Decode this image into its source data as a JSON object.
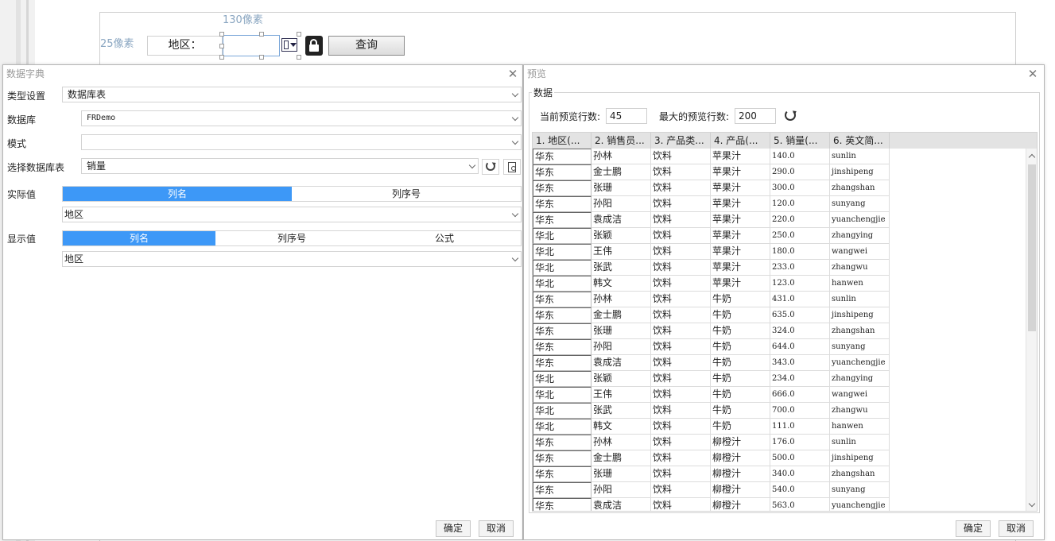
{
  "designer": {
    "dim_top": "130像素",
    "dim_left": "25像素",
    "region_label": "地区：",
    "query_button": "查询"
  },
  "dict_dialog": {
    "title": "数据字典",
    "type_label": "类型设置",
    "type_value": "数据库表",
    "db_label": "数据库",
    "db_value": "FRDemo",
    "mode_label": "模式",
    "mode_value": "",
    "table_label": "选择数据库表",
    "table_value": "销量",
    "actual_label": "实际值",
    "actual_tabs": [
      "列名",
      "列序号"
    ],
    "actual_value": "地区",
    "display_label": "显示值",
    "display_tabs": [
      "列名",
      "列序号",
      "公式"
    ],
    "display_value": "地区",
    "ok": "确定",
    "cancel": "取消"
  },
  "preview_dialog": {
    "title": "预览",
    "group_title": "数据",
    "current_rows_label": "当前预览行数:",
    "current_rows": "45",
    "max_rows_label": "最大的预览行数:",
    "max_rows": "200",
    "columns": [
      "1. 地区(...",
      "2. 销售员...",
      "3. 产品类...",
      "4. 产品(...",
      "5. 销量(...",
      "6. 英文简..."
    ],
    "rows": [
      [
        "华东",
        "孙林",
        "饮料",
        "苹果汁",
        "140.0",
        "sunlin"
      ],
      [
        "华东",
        "金士鹏",
        "饮料",
        "苹果汁",
        "290.0",
        "jinshipeng"
      ],
      [
        "华东",
        "张珊",
        "饮料",
        "苹果汁",
        "300.0",
        "zhangshan"
      ],
      [
        "华东",
        "孙阳",
        "饮料",
        "苹果汁",
        "120.0",
        "sunyang"
      ],
      [
        "华东",
        "袁成洁",
        "饮料",
        "苹果汁",
        "220.0",
        "yuanchengjie"
      ],
      [
        "华北",
        "张颖",
        "饮料",
        "苹果汁",
        "250.0",
        "zhangying"
      ],
      [
        "华北",
        "王伟",
        "饮料",
        "苹果汁",
        "180.0",
        "wangwei"
      ],
      [
        "华北",
        "张武",
        "饮料",
        "苹果汁",
        "233.0",
        "zhangwu"
      ],
      [
        "华北",
        "韩文",
        "饮料",
        "苹果汁",
        "123.0",
        "hanwen"
      ],
      [
        "华东",
        "孙林",
        "饮料",
        "牛奶",
        "431.0",
        "sunlin"
      ],
      [
        "华东",
        "金士鹏",
        "饮料",
        "牛奶",
        "635.0",
        "jinshipeng"
      ],
      [
        "华东",
        "张珊",
        "饮料",
        "牛奶",
        "324.0",
        "zhangshan"
      ],
      [
        "华东",
        "孙阳",
        "饮料",
        "牛奶",
        "644.0",
        "sunyang"
      ],
      [
        "华东",
        "袁成洁",
        "饮料",
        "牛奶",
        "343.0",
        "yuanchengjie"
      ],
      [
        "华北",
        "张颖",
        "饮料",
        "牛奶",
        "234.0",
        "zhangying"
      ],
      [
        "华北",
        "王伟",
        "饮料",
        "牛奶",
        "666.0",
        "wangwei"
      ],
      [
        "华北",
        "张武",
        "饮料",
        "牛奶",
        "700.0",
        "zhangwu"
      ],
      [
        "华北",
        "韩文",
        "饮料",
        "牛奶",
        "111.0",
        "hanwen"
      ],
      [
        "华东",
        "孙林",
        "饮料",
        "柳橙汁",
        "176.0",
        "sunlin"
      ],
      [
        "华东",
        "金士鹏",
        "饮料",
        "柳橙汁",
        "500.0",
        "jinshipeng"
      ],
      [
        "华东",
        "张珊",
        "饮料",
        "柳橙汁",
        "340.0",
        "zhangshan"
      ],
      [
        "华东",
        "孙阳",
        "饮料",
        "柳橙汁",
        "540.0",
        "sunyang"
      ],
      [
        "华东",
        "袁成洁",
        "饮料",
        "柳橙汁",
        "563.0",
        "yuanchengjie"
      ]
    ],
    "ok": "确定",
    "cancel": "取消"
  },
  "colors": {
    "accent": "#3d98f7",
    "selection_border": "#7aa7d9"
  }
}
